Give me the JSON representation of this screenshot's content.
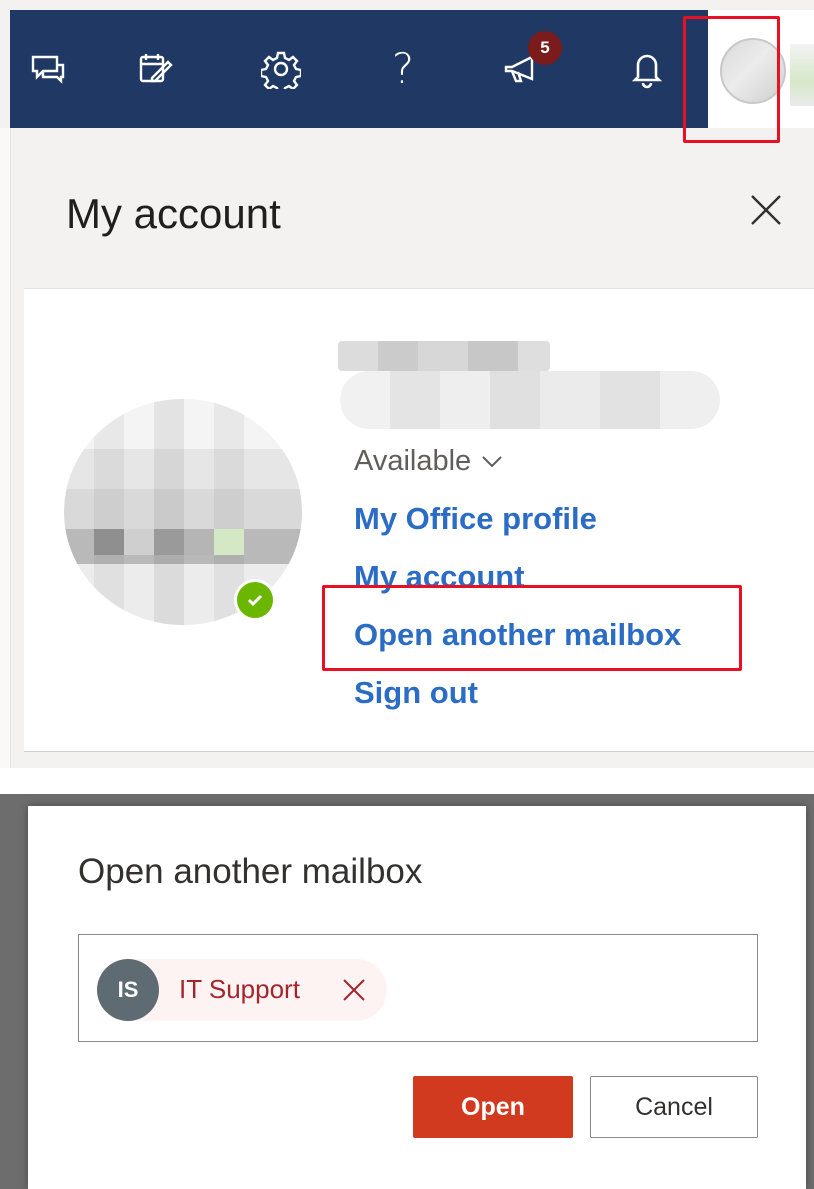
{
  "header": {
    "icons": [
      "chat-icon",
      "task-icon",
      "gear-icon",
      "help-icon",
      "megaphone-icon",
      "bell-icon"
    ],
    "help_glyph": "?",
    "whats_new_count": "5",
    "bar_color": "#1f3864"
  },
  "account_panel": {
    "title": "My account",
    "status": "Available",
    "links": {
      "office_profile": "My Office profile",
      "my_account": "My account",
      "open_mailbox": "Open another mailbox",
      "sign_out": "Sign out"
    },
    "presence_color": "#6bb700",
    "link_color": "#2b6cc4"
  },
  "dialog": {
    "title": "Open another mailbox",
    "recipient": {
      "initials": "IS",
      "name": "IT Support"
    },
    "open_label": "Open",
    "cancel_label": "Cancel",
    "accent_color": "#d13a1e"
  },
  "annotations": {
    "highlight_color": "#e81123"
  }
}
